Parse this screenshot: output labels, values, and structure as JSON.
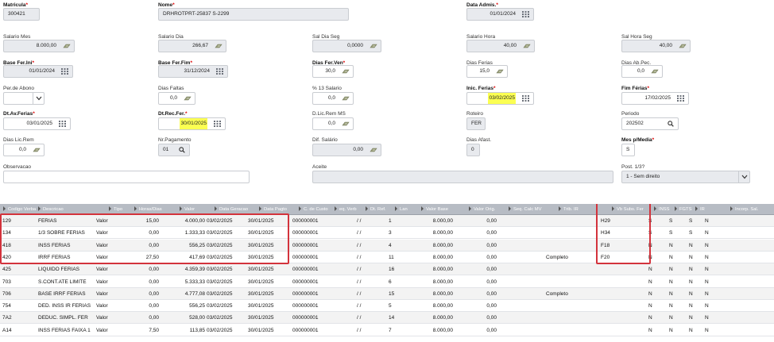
{
  "fields": {
    "matricula": {
      "label": "Matricula",
      "value": "300421"
    },
    "nome": {
      "label": "Nome",
      "value": "DRHROTPRT-25837  S-2299"
    },
    "data_admis": {
      "label": "Data Admis.",
      "value": "01/01/2024"
    },
    "salario_mes": {
      "label": "Salario Mes",
      "value": "8.000,00"
    },
    "salario_dia": {
      "label": "Salario Dia",
      "value": "266,67"
    },
    "sal_dia_seg": {
      "label": "Sal Dia Seg",
      "value": "0,0000"
    },
    "salario_hora": {
      "label": "Salario Hora",
      "value": "40,00"
    },
    "sal_hora_seg": {
      "label": "Sal Hora Seg",
      "value": "40,00"
    },
    "base_fer_ini": {
      "label": "Base Fer.Ini",
      "value": "01/01/2024"
    },
    "base_fer_fim": {
      "label": "Base Fer.Fim",
      "value": "31/12/2024"
    },
    "dias_fer_ven": {
      "label": "Dias Fer.Ven",
      "value": "30,0"
    },
    "dias_ferias": {
      "label": "Dias Ferias",
      "value": "15,0"
    },
    "dias_ab_pec": {
      "label": "Dias Ab.Pec.",
      "value": "0,0"
    },
    "per_abono": {
      "label": "Per.de Abono",
      "value": ""
    },
    "dias_faltas": {
      "label": "Dias Faltas",
      "value": "0,0"
    },
    "pct_13_salario": {
      "label": "% 13 Salario",
      "value": "0,0"
    },
    "inic_ferias": {
      "label": "Inic. Ferias",
      "value": "03/02/2025"
    },
    "fim_ferias": {
      "label": "Fim Férias",
      "value": "17/02/2025"
    },
    "dt_av_ferias": {
      "label": "Dt.Av.Ferias",
      "value": "03/01/2025"
    },
    "dt_rec_fer": {
      "label": "Dt.Rec.Fer.",
      "value": "30/01/2025"
    },
    "d_lic_rem_ms": {
      "label": "D.Lic.Rem MS",
      "value": "0,0"
    },
    "roteiro": {
      "label": "Roteiro",
      "value": "FER"
    },
    "periodo": {
      "label": "Periodo",
      "value": "202502"
    },
    "dias_lic_rem": {
      "label": "Dias Lic.Rem",
      "value": "0,0"
    },
    "nr_pagamento": {
      "label": "Nr.Pagamento",
      "value": "01"
    },
    "dif_salario": {
      "label": "Dif. Salário",
      "value": "0,00"
    },
    "dias_afast": {
      "label": "Dias Afast.",
      "value": "0"
    },
    "mes_p_media": {
      "label": "Mes p/Media",
      "value": "S"
    },
    "observacao": {
      "label": "Observacao",
      "value": ""
    },
    "aceite": {
      "label": "Aceite",
      "value": ""
    },
    "post_13": {
      "label": "Post. 1/3?",
      "value": "1 - Sem direito"
    }
  },
  "grid": {
    "columns": [
      "Codigo Verba",
      "Descricao",
      "Tipo",
      "Horas/Dias",
      "Valor",
      "Data Geracao",
      "Data Pagto",
      "C. de Custo",
      "eq. Verb",
      "Dt. Ref.",
      "Lan",
      "Valor Base",
      "Valor Orig.",
      "Seq. Calc MV",
      "Trib. IR",
      "Vb Subs. Fer",
      "INSS",
      "FGTS",
      "IR",
      "Incorp. Sal."
    ],
    "rows": [
      [
        "129",
        "FERIAS",
        "Valor",
        "15,00",
        "4.000,00",
        "03/02/2025",
        "30/01/2025",
        "000000001",
        "/ /",
        "1",
        "8.000,00",
        "0,00",
        "",
        "",
        "H29",
        "S",
        "S",
        "S",
        "N"
      ],
      [
        "134",
        "1/3 SOBRE FERIAS",
        "Valor",
        "0,00",
        "1.333,33",
        "03/02/2025",
        "30/01/2025",
        "000000001",
        "/ /",
        "3",
        "8.000,00",
        "0,00",
        "",
        "",
        "H34",
        "S",
        "S",
        "S",
        "N"
      ],
      [
        "418",
        "INSS FERIAS",
        "Valor",
        "0,00",
        "556,25",
        "03/02/2025",
        "30/01/2025",
        "000000001",
        "/ /",
        "4",
        "8.000,00",
        "0,00",
        "",
        "",
        "F18",
        "N",
        "N",
        "N",
        "N"
      ],
      [
        "420",
        "IRRF FERIAS",
        "Valor",
        "27,50",
        "417,69",
        "03/02/2025",
        "30/01/2025",
        "000000001",
        "/ /",
        "11",
        "8.000,00",
        "0,00",
        "",
        "Completo",
        "F20",
        "N",
        "N",
        "N",
        "N"
      ],
      [
        "425",
        "LIQUIDO FERIAS",
        "Valor",
        "0,00",
        "4.359,39",
        "03/02/2025",
        "30/01/2025",
        "000000001",
        "/ /",
        "16",
        "8.000,00",
        "0,00",
        "",
        "",
        "",
        "N",
        "N",
        "N",
        "N"
      ],
      [
        "703",
        "S.CONT.ATE LIMITE",
        "Valor",
        "0,00",
        "5.333,33",
        "03/02/2025",
        "30/01/2025",
        "000000001",
        "/ /",
        "6",
        "8.000,00",
        "0,00",
        "",
        "",
        "",
        "N",
        "N",
        "N",
        "N"
      ],
      [
        "706",
        "BASE IRRF FERIAS",
        "Valor",
        "0,00",
        "4.777,08",
        "03/02/2025",
        "30/01/2025",
        "000000001",
        "/ /",
        "15",
        "8.000,00",
        "0,00",
        "",
        "Completo",
        "",
        "N",
        "N",
        "N",
        "N"
      ],
      [
        "754",
        "DED. INSS IR FERIAS",
        "Valor",
        "0,00",
        "556,25",
        "03/02/2025",
        "30/01/2025",
        "000000001",
        "/ /",
        "5",
        "8.000,00",
        "0,00",
        "",
        "",
        "",
        "N",
        "N",
        "N",
        "N"
      ],
      [
        "7A2",
        "DEDUC. SIMPL. FER",
        "Valor",
        "0,00",
        "528,00",
        "03/02/2025",
        "30/01/2025",
        "000000001",
        "/ /",
        "14",
        "8.000,00",
        "0,00",
        "",
        "",
        "",
        "N",
        "N",
        "N",
        "N"
      ],
      [
        "A14",
        "INSS FERIAS FAIXA 1",
        "Valor",
        "7,50",
        "113,85",
        "03/02/2025",
        "30/01/2025",
        "000000001",
        "/ /",
        "7",
        "8.000,00",
        "0,00",
        "",
        "",
        "",
        "N",
        "N",
        "N",
        "N"
      ]
    ]
  },
  "colors": {
    "highlight": "#fbff52",
    "annotation_border": "#d3333c",
    "header_bg": "#b7bcc4"
  }
}
